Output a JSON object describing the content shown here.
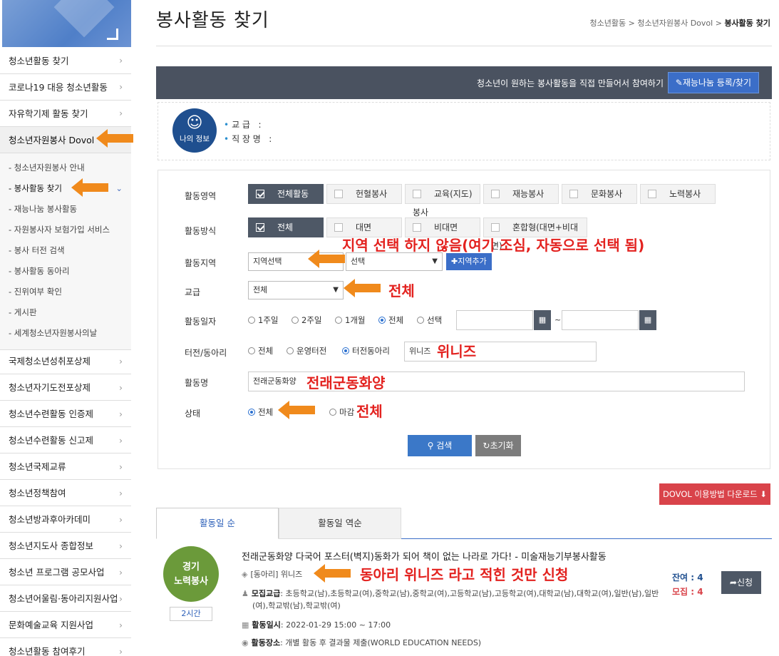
{
  "header": {
    "title": "봉사활동 찾기",
    "breadcrumb": [
      "청소년활동",
      "청소년자원봉사 Dovol",
      "봉사활동 찾기"
    ]
  },
  "sidebar": {
    "items_top": [
      {
        "label": "청소년활동 찾기"
      },
      {
        "label": "코로나19 대응 청소년활동"
      },
      {
        "label": "자유학기제 활동 찾기"
      },
      {
        "label": "청소년자원봉사 Dovol"
      }
    ],
    "submenu": [
      {
        "label": "- 청소년자원봉사 안내"
      },
      {
        "label": "- 봉사활동 찾기"
      },
      {
        "label": "- 재능나눔 봉사활동"
      },
      {
        "label": "- 자원봉사자 보험가입 서비스"
      },
      {
        "label": "- 봉사 터전 검색"
      },
      {
        "label": "- 봉사활동 동아리"
      },
      {
        "label": "- 진위여부 확인"
      },
      {
        "label": "- 게시판"
      },
      {
        "label": "- 세계청소년자원봉사의날"
      }
    ],
    "items_bottom": [
      {
        "label": "국제청소년성취포상제"
      },
      {
        "label": "청소년자기도전포상제"
      },
      {
        "label": "청소년수련활동 인증제"
      },
      {
        "label": "청소년수련활동 신고제"
      },
      {
        "label": "청소년국제교류"
      },
      {
        "label": "청소년정책참여"
      },
      {
        "label": "청소년방과후아카데미"
      },
      {
        "label": "청소년지도사 종합정보"
      },
      {
        "label": "청소년 프로그램 공모사업"
      },
      {
        "label": "청소년어울림·동아리지원사업"
      },
      {
        "label": "문화예술교육 지원사업"
      },
      {
        "label": "청소년활동 참여후기"
      }
    ]
  },
  "talent_bar": {
    "text": "청소년이 원하는 봉사활동을 직접 만들어서 참여하기",
    "button": "재능나눔 등록/찾기"
  },
  "my_info": {
    "avatar_label": "나의 정보",
    "school_label": "교   급",
    "school_value": ":",
    "job_label": "직 장 명",
    "job_value": ":"
  },
  "form": {
    "area_label": "활동영역",
    "areas": [
      "전체활동",
      "헌혈봉사",
      "교육(지도)봉사",
      "재능봉사",
      "문화봉사",
      "노력봉사"
    ],
    "method_label": "활동방식",
    "methods": [
      "전체",
      "대면",
      "비대면",
      "혼합형(대면+비대면)"
    ],
    "region_label": "활동지역",
    "region_select": "지역선택",
    "region_select2": "선택",
    "region_add": "지역추가",
    "school_label": "교급",
    "school_select": "전체",
    "date_label": "활동일자",
    "date_options": [
      "1주일",
      "2주일",
      "1개월",
      "전체",
      "선택"
    ],
    "date_sep": "~",
    "place_label": "터전/동아리",
    "place_options": [
      "전체",
      "운영터전",
      "터전동아리"
    ],
    "place_value": "위니즈",
    "name_label": "활동명",
    "name_value": "전래군동화양",
    "status_label": "상태",
    "status_options": [
      "전체",
      "마감"
    ],
    "search_button": "검색",
    "reset_button": "초기화"
  },
  "annotations": {
    "region": "지역 선택 하지 않음(여기 조심, 자동으로 선택 됨)",
    "school": "전체",
    "place": "위니즈",
    "name": "전래군동화양",
    "status": "전체",
    "result": "동아리 위니즈 라고 적힌 것만 신청"
  },
  "download_button": "DOVOL 이용방법 다운로드",
  "tabs": [
    "활동일 순",
    "활동일 역순"
  ],
  "result": {
    "badge_line1": "경기",
    "badge_line2": "노력봉사",
    "hours": "2시간",
    "title": "전래군동화양 다국어 포스터(벽지)동화가 되어 책이 없는 나라로 가다! - 미술재능기부봉사활동",
    "club": "[동아리] 위니즈",
    "recruit_label": "모집교급",
    "recruit_text": ": 초등학교(남),초등학교(여),중학교(남),중학교(여),고등학교(남),고등학교(여),대학교(남),대학교(여),일반(남),일반",
    "recruit_text2": "(여),학교밖(남),학교밖(여)",
    "date_label": "활동일시",
    "date_value": ": 2022-01-29   15:00 ~ 17:00",
    "place_label": "활동장소",
    "place_value": ": 개별 활동 후 결과물 제출(WORLD EDUCATION NEEDS)",
    "remain": "잔여 : 4",
    "recruit": "모집 : 4",
    "apply": "신청"
  },
  "colors": {
    "accent": "#3b6ec8",
    "annotation": "#e3221f",
    "arrow": "#f08a1c",
    "badge": "#6b9a3a"
  }
}
